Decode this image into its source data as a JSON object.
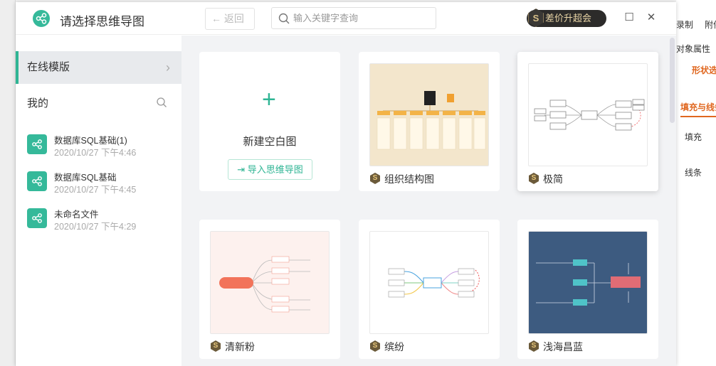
{
  "header": {
    "title": "请选择思维导图",
    "back_label": "← 返回",
    "search_placeholder": "输入关键字查询",
    "promo_label": "差价升超会",
    "maximize": "☐",
    "close": "✕"
  },
  "sidebar": {
    "online_label": "在线模版",
    "mine_label": "我的",
    "files": [
      {
        "name": "数据库SQL基础(1)",
        "date": "2020/10/27 下午4:46"
      },
      {
        "name": "数据库SQL基础",
        "date": "2020/10/27 下午4:45"
      },
      {
        "name": "未命名文件",
        "date": "2020/10/27 下午4:29"
      }
    ]
  },
  "new_card": {
    "plus": "+",
    "label": "新建空白图",
    "import_label": "导入思维导图"
  },
  "templates": [
    {
      "name": "组织结构图",
      "bg": "#f3e6cc"
    },
    {
      "name": "极简",
      "bg": "#ffffff"
    },
    {
      "name": "清新粉",
      "bg": "#fdf1ee"
    },
    {
      "name": "缤纷",
      "bg": "#ffffff"
    },
    {
      "name": "浅海昌蓝",
      "bg": "#3d5b80"
    }
  ],
  "background_app": {
    "record": "录制",
    "attach": "附件",
    "object_props": "对象属性",
    "shape": "形状选项",
    "fill_line": "填充与线条",
    "fill": "填充",
    "line": "线条"
  },
  "colors": {
    "accent": "#2fb594",
    "panel_accent": "#e0671f"
  }
}
